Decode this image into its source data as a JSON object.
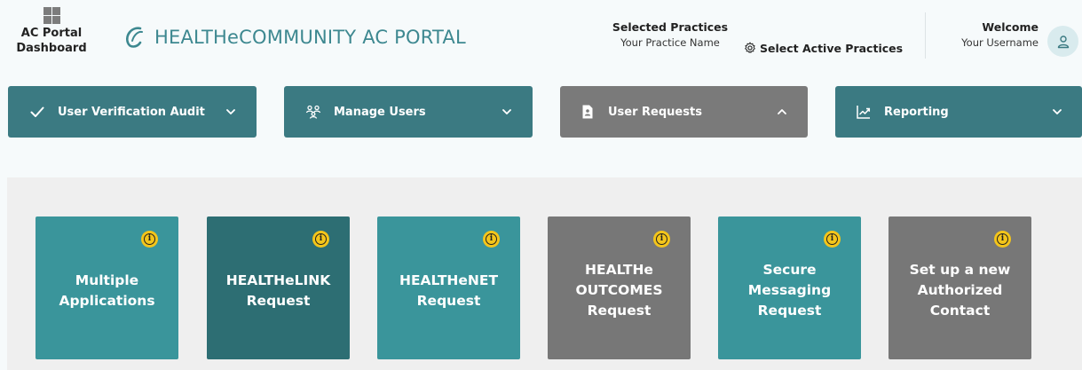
{
  "header": {
    "dashboard_label": "AC Portal\nDashboard",
    "portal_title": "HEALTHeCOMMUNITY AC PORTAL",
    "selected_practices_title": "Selected Practices",
    "practice_name": "Your Practice Name",
    "select_active_label": "Select Active Practices",
    "welcome_title": "Welcome",
    "username": "Your Username"
  },
  "colors": {
    "brand_teal": "#3d8890",
    "nav_teal": "#3b7a82",
    "nav_gray": "#7a7a7a",
    "card_teal": "#3a959b",
    "card_dark_teal": "#2d6e73",
    "card_gray": "#777777",
    "info_yellow": "#f4c51a"
  },
  "nav": [
    {
      "label": "User Verification Audit",
      "icon": "check-icon",
      "chevron": "down",
      "style": "teal"
    },
    {
      "label": "Manage Users",
      "icon": "users-icon",
      "chevron": "down",
      "style": "teal"
    },
    {
      "label": "User Requests",
      "icon": "request-doc-icon",
      "chevron": "up",
      "style": "gray",
      "expanded": true
    },
    {
      "label": "Reporting",
      "icon": "chart-icon",
      "chevron": "down",
      "style": "teal"
    }
  ],
  "cards": [
    {
      "label": "Multiple\nApplications",
      "style": "teal",
      "info_icon": "info-icon"
    },
    {
      "label": "HEALTHeLINK\nRequest",
      "style": "dark-teal",
      "info_icon": "info-icon"
    },
    {
      "label": "HEALTHeNET\nRequest",
      "style": "teal",
      "info_icon": "info-icon"
    },
    {
      "label": "HEALTHe\nOUTCOMES\nRequest",
      "style": "gray",
      "info_icon": "info-icon"
    },
    {
      "label": "Secure\nMessaging\nRequest",
      "style": "teal",
      "info_icon": "info-icon"
    },
    {
      "label": "Set up a new\nAuthorized\nContact",
      "style": "gray",
      "info_icon": "info-icon"
    }
  ]
}
